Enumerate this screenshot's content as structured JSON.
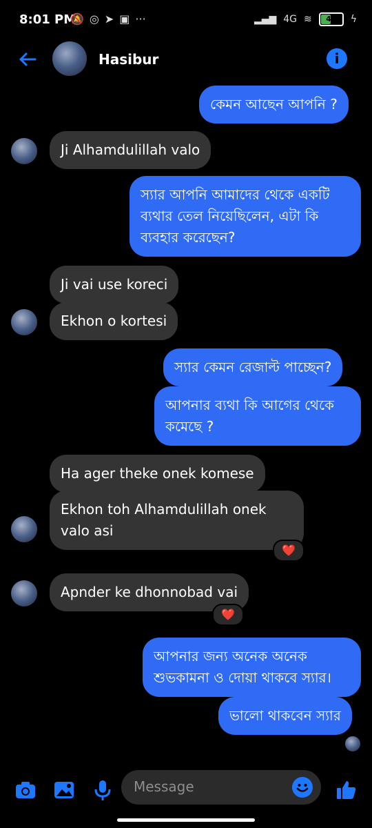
{
  "status": {
    "time": "8:01 PM",
    "left_icons": [
      "mute-bell",
      "whatsapp",
      "telegram",
      "app-icon",
      "more"
    ],
    "network": "4G",
    "battery": "48",
    "battery_level": 0.48
  },
  "header": {
    "contact_name": "Hasibur"
  },
  "messages": [
    {
      "from": "me",
      "text": "কেমন আছেন আপনি ?"
    },
    {
      "from": "them",
      "text": "Ji Alhamdulillah valo"
    },
    {
      "from": "me",
      "text": "স্যার আপনি আমাদের থেকে একটি ব্যথার তেল নিয়েছিলেন, এটা কি ব্যবহার করেছেন?"
    },
    {
      "from": "them",
      "text": "Ji vai use koreci"
    },
    {
      "from": "them",
      "text": "Ekhon o kortesi"
    },
    {
      "from": "me",
      "text": "স্যার কেমন রেজাল্ট পাচ্ছেন?"
    },
    {
      "from": "me",
      "text": "আপনার ব্যথা কি আগের থেকে কমেছে ?"
    },
    {
      "from": "them",
      "text": "Ha ager theke onek komese"
    },
    {
      "from": "them",
      "text": "Ekhon toh Alhamdulillah onek valo asi",
      "reaction": "❤️"
    },
    {
      "from": "them",
      "text": "Apnder ke dhonnobad vai",
      "reaction": "❤️"
    },
    {
      "from": "me",
      "text": "আপনার জন্য অনেক অনেক শুভকামনা ও দোয়া থাকবে স্যার।"
    },
    {
      "from": "me",
      "text": "ভালো থাকবেন স্যার"
    }
  ],
  "composer": {
    "placeholder": "Message"
  },
  "colors": {
    "accent": "#1d77ff",
    "outgoing_bubble": "#2f6bf5",
    "incoming_bubble": "#343434",
    "background": "#000000"
  }
}
